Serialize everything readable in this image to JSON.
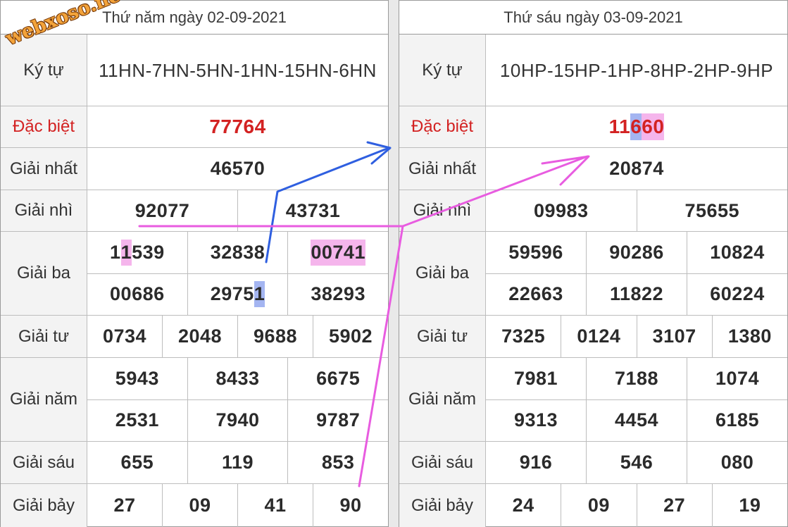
{
  "watermark": "webxoso.net",
  "accent_colors": {
    "special_prize": "#d32222",
    "highlight_pink": "#ec78dc",
    "highlight_blue": "#5a78e6",
    "arrow_pink": "#e85ce0",
    "arrow_blue": "#2f5fe0"
  },
  "left": {
    "header": "Thứ năm ngày 02-09-2021",
    "labels": {
      "code": "Ký tự",
      "special": "Đặc biệt",
      "first": "Giải nhất",
      "second": "Giải nhì",
      "third": "Giải ba",
      "fourth": "Giải tư",
      "fifth": "Giải năm",
      "sixth": "Giải sáu",
      "seventh": "Giải bảy"
    },
    "code": "11HN-7HN-5HN-1HN-15HN-6HN",
    "special": "77764",
    "first": "46570",
    "second": [
      "92077",
      "43731"
    ],
    "third": {
      "pre": [
        "1",
        "3283",
        "0074"
      ],
      "hi": [
        "1",
        "8",
        "1"
      ],
      "post": [
        "539",
        "",
        ""
      ],
      "row2": [
        "00686",
        "2975",
        "38293"
      ],
      "row2_hi": "1"
    },
    "fourth": [
      "0734",
      "2048",
      "9688",
      "5902"
    ],
    "fifth": [
      "5943",
      "8433",
      "6675",
      "2531",
      "7940",
      "9787"
    ],
    "sixth": [
      "655",
      "119",
      "853"
    ],
    "seventh": [
      "27",
      "09",
      "41",
      "90"
    ]
  },
  "right": {
    "header": "Thứ sáu ngày 03-09-2021",
    "labels": {
      "code": "Ký tự",
      "special": "Đặc biệt",
      "first": "Giải nhất",
      "second": "Giải nhì",
      "third": "Giải ba",
      "fourth": "Giải tư",
      "fifth": "Giải năm",
      "sixth": "Giải sáu",
      "seventh": "Giải bảy"
    },
    "code": "10HP-15HP-1HP-8HP-2HP-9HP",
    "special": "11660",
    "first": "20874",
    "second": [
      "09983",
      "75655"
    ],
    "third": [
      "59596",
      "90286",
      "10824",
      "22663",
      "11822",
      "60224"
    ],
    "fourth": [
      "7325",
      "0124",
      "3107",
      "1380"
    ],
    "fifth": [
      "7981",
      "7188",
      "1074",
      "9313",
      "4454",
      "6185"
    ],
    "sixth": [
      "916",
      "546",
      "080"
    ],
    "seventh": [
      "24",
      "09",
      "27",
      "19"
    ]
  }
}
